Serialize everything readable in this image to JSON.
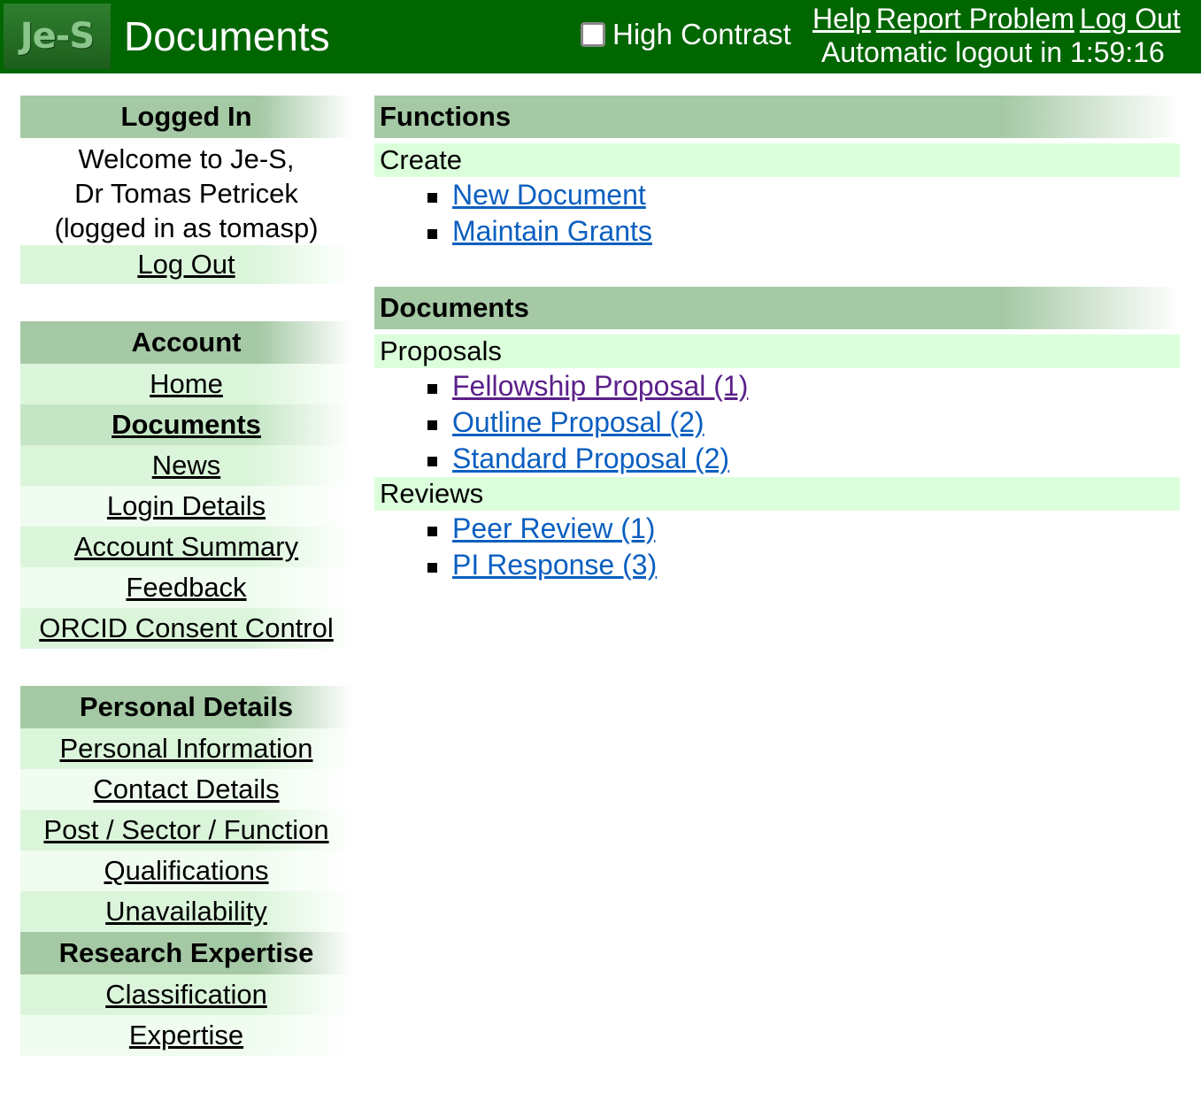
{
  "header": {
    "logo_text": "Je-S",
    "title": "Documents",
    "high_contrast_label": "High Contrast",
    "high_contrast_checked": false,
    "links": {
      "help": "Help",
      "report_problem": "Report Problem",
      "log_out": "Log Out"
    },
    "auto_logout": "Automatic logout in 1:59:16"
  },
  "sidebar": {
    "logged_in": {
      "heading": "Logged In",
      "welcome_line1": "Welcome to Je-S,",
      "welcome_line2": "Dr Tomas Petricek",
      "welcome_line3": "(logged in as tomasp)",
      "log_out": "Log Out"
    },
    "account": {
      "heading": "Account",
      "items": [
        "Home",
        "Documents",
        "News",
        "Login Details",
        "Account Summary",
        "Feedback",
        "ORCID Consent Control"
      ],
      "active": "Documents"
    },
    "personal_details": {
      "heading": "Personal Details",
      "items": [
        "Personal Information",
        "Contact Details",
        "Post / Sector / Function",
        "Qualifications",
        "Unavailability"
      ]
    },
    "research_expertise": {
      "heading": "Research Expertise",
      "items": [
        "Classification",
        "Expertise"
      ]
    }
  },
  "main": {
    "functions": {
      "heading": "Functions",
      "create_label": "Create",
      "create_links": [
        "New Document",
        "Maintain Grants"
      ]
    },
    "documents": {
      "heading": "Documents",
      "proposals_label": "Proposals",
      "proposals": [
        "Fellowship Proposal (1)",
        "Outline Proposal (2)",
        "Standard Proposal (2)"
      ],
      "reviews_label": "Reviews",
      "reviews": [
        "Peer Review (1)",
        "PI Response (3)"
      ]
    }
  },
  "colors": {
    "header_bg": "#006600",
    "section_head": "#a5c9a5",
    "subsection_bg": "#dbffdb",
    "link": "#0b5fc0",
    "visited_link": "#5b1f8a"
  }
}
